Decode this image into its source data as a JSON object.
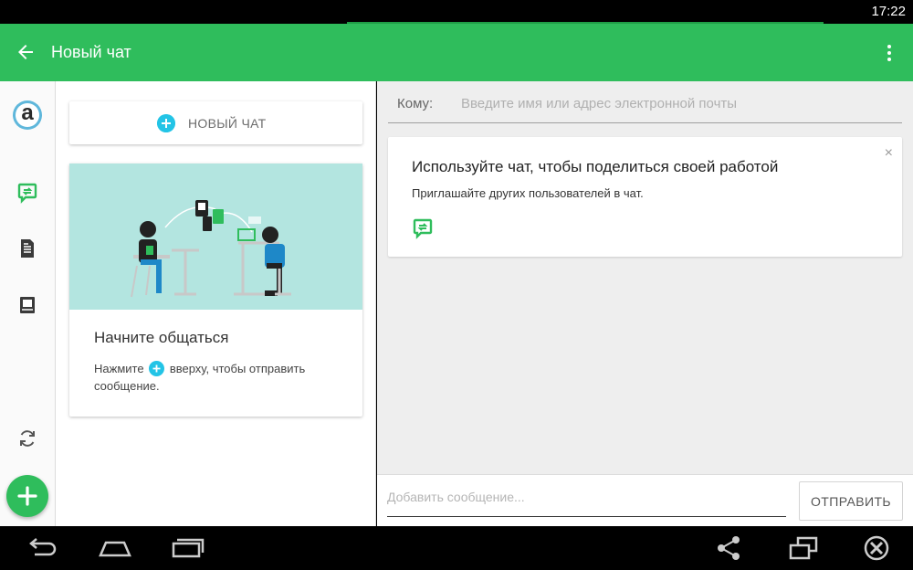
{
  "status_bar": {
    "time": "17:22"
  },
  "app_bar": {
    "title": "Новый чат",
    "back_icon": "arrow-back-icon",
    "more_icon": "more-vert-icon"
  },
  "rail": {
    "avatar_letter": "a",
    "items": [
      {
        "name": "chat",
        "icon": "chat-share-icon",
        "color": "#2fbd5c"
      },
      {
        "name": "document",
        "icon": "document-icon"
      },
      {
        "name": "notebook",
        "icon": "notebook-icon"
      },
      {
        "name": "sync",
        "icon": "sync-icon"
      }
    ],
    "fab_icon": "plus-icon"
  },
  "middle": {
    "new_chat_label": "НОВЫЙ ЧАТ",
    "card": {
      "title": "Начните общаться",
      "body_before": "Нажмите",
      "body_after": "вверху, чтобы отправить сообщение."
    }
  },
  "right": {
    "to_label": "Кому:",
    "to_placeholder": "Введите имя или адрес электронной почты",
    "tip": {
      "title": "Используйте чат, чтобы поделиться своей работой",
      "body": "Приглашайте других пользователей в чат.",
      "close": "×"
    },
    "composer": {
      "placeholder": "Добавить сообщение...",
      "send_label": "ОТПРАВИТЬ"
    }
  },
  "nav_bar": {
    "buttons": [
      "back-icon",
      "home-icon",
      "recents-icon",
      "share-icon",
      "screen-mirror-icon",
      "close-circle-icon"
    ]
  },
  "colors": {
    "primary": "#2fbd5c",
    "accent": "#23c4e6",
    "illustration_bg": "#b3e5e0"
  }
}
